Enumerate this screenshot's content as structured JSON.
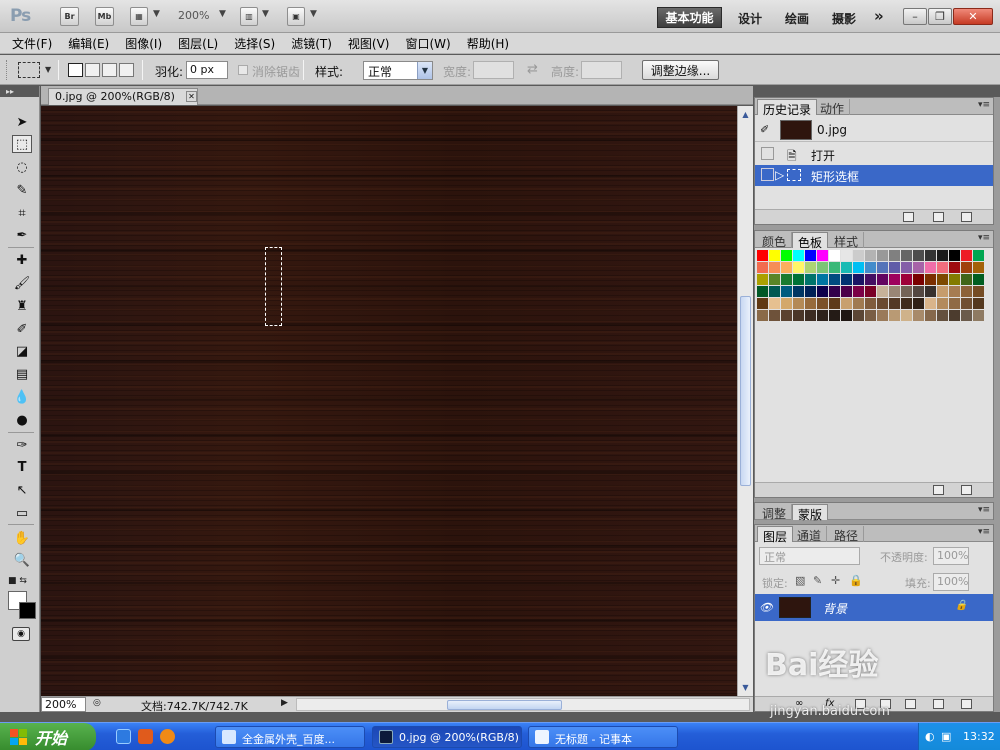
{
  "app": {
    "logo": "Ps",
    "bridge_label": "Br",
    "minibridge_label": "Mb",
    "zoom_level": "200%",
    "workspaces": {
      "active": "基本功能",
      "design": "设计",
      "painting": "绘画",
      "photography": "摄影",
      "more": "»"
    }
  },
  "menu": [
    "文件(F)",
    "编辑(E)",
    "图像(I)",
    "图层(L)",
    "选择(S)",
    "滤镜(T)",
    "视图(V)",
    "窗口(W)",
    "帮助(H)"
  ],
  "options": {
    "feather_label": "羽化:",
    "feather_value": "0 px",
    "antialias_label": "消除锯齿",
    "style_label": "样式:",
    "style_value": "正常",
    "width_label": "宽度:",
    "height_label": "高度:",
    "refine_edge_label": "调整边缘..."
  },
  "document": {
    "tab_title": "0.jpg @ 200%(RGB/8)",
    "zoom": "200%",
    "doc_info": "文档:742.7K/742.7K"
  },
  "history_panel": {
    "tabs": [
      "历史记录",
      "动作"
    ],
    "snapshot": "0.jpg",
    "steps": [
      "打开",
      "矩形选框"
    ],
    "selected_step": "矩形选框"
  },
  "swatches_panel": {
    "tabs": [
      "颜色",
      "色板",
      "样式"
    ],
    "active_tab": "色板",
    "colors": [
      "#ff0000",
      "#ffff00",
      "#00ff00",
      "#00ffff",
      "#0000ff",
      "#ff00ff",
      "#ffffff",
      "#e6e6e6",
      "#cccccc",
      "#b3b3b3",
      "#999999",
      "#808080",
      "#666666",
      "#4d4d4d",
      "#333333",
      "#1a1a1a",
      "#000000",
      "#ed1c24",
      "#00a651",
      "#f26c4f",
      "#f68e56",
      "#fbaf5d",
      "#fff568",
      "#acd373",
      "#7cc576",
      "#3bb878",
      "#1abbb4",
      "#00bff3",
      "#438ccb",
      "#5574b9",
      "#605ca8",
      "#855fa8",
      "#a763a8",
      "#f06ea9",
      "#f26d7d",
      "#9e0b0f",
      "#a0410d",
      "#a36209",
      "#aba000",
      "#598527",
      "#1a7b30",
      "#007236",
      "#00746b",
      "#0076a3",
      "#004b80",
      "#003471",
      "#1b1464",
      "#440e62",
      "#630460",
      "#9e005d",
      "#9e0039",
      "#790000",
      "#7b2e00",
      "#7d4900",
      "#827b00",
      "#406618",
      "#005e20",
      "#005826",
      "#005952",
      "#005b7f",
      "#003663",
      "#002157",
      "#0d004c",
      "#32004b",
      "#4b0049",
      "#7b0046",
      "#7a0026",
      "#c7b299",
      "#998675",
      "#736357",
      "#534741",
      "#37302d",
      "#c69c6d",
      "#a67c52",
      "#8c6239",
      "#754c24",
      "#603913",
      "#e6c090",
      "#d3a86b",
      "#b48a56",
      "#976b3c",
      "#7b5129",
      "#5e3a1a",
      "#c8a06e",
      "#a07a50",
      "#805c3c",
      "#6a4a30",
      "#533925",
      "#3f2b1c",
      "#2f2016",
      "#d9b48a",
      "#b38a5c",
      "#8f6a45",
      "#704f32",
      "#55391f",
      "#8a6a48",
      "#6e523a",
      "#5a4230",
      "#4a3628",
      "#3c2c22",
      "#2e221b",
      "#241b16",
      "#1e1612",
      "#5b4635",
      "#7a5e45",
      "#9a7a5a",
      "#b99a74",
      "#cfb28a",
      "#a88a6a",
      "#86684c",
      "#64503e",
      "#4c3c2e",
      "#6a5a4a",
      "#8e7a62"
    ]
  },
  "adjustments_panel": {
    "tabs": [
      "调整",
      "蒙版"
    ]
  },
  "layers_panel": {
    "tabs": [
      "图层",
      "通道",
      "路径"
    ],
    "blend_mode": "正常",
    "opacity_label": "不透明度:",
    "opacity_value": "100%",
    "lock_label": "锁定:",
    "fill_label": "填充:",
    "fill_value": "100%",
    "layer_name": "背景"
  },
  "taskbar": {
    "start": "开始",
    "items": [
      "全金属外壳_百度...",
      "0.jpg @ 200%(RGB/8)",
      "无标题 - 记事本"
    ],
    "clock": "13:32"
  },
  "watermark": {
    "brand": "Bai经验",
    "url": "jingyan.baidu.com"
  }
}
